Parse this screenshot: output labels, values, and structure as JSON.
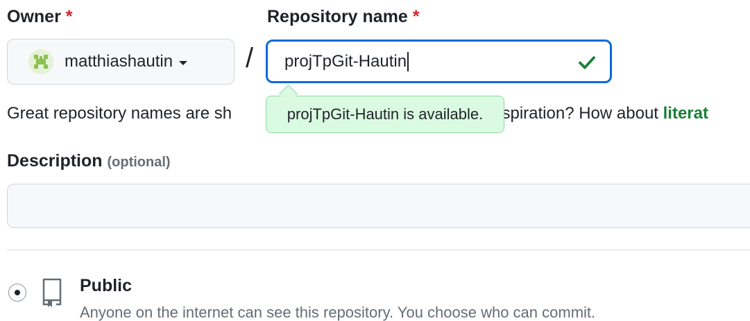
{
  "owner": {
    "label": "Owner",
    "required_mark": "*",
    "value": "matthiashautin"
  },
  "separator": "/",
  "repository_name": {
    "label": "Repository name",
    "required_mark": "*",
    "value": "projTpGit-Hautin",
    "availability_message": "projTpGit-Hautin is available."
  },
  "help": {
    "text_prefix": "Great repository names are sh",
    "text_middle": "nspiration? How about ",
    "suggestion": "literat"
  },
  "description": {
    "label": "Description",
    "optional_label": "(optional)",
    "value": ""
  },
  "visibility": {
    "public": {
      "title": "Public",
      "description": "Anyone on the internet can see this repository. You choose who can commit.",
      "selected": true
    }
  },
  "colors": {
    "focus_border": "#0969da",
    "success": "#1a7f37",
    "required": "#d1242f",
    "tooltip_bg": "#dafbe1"
  },
  "icons": {
    "avatar": "identicon-avatar",
    "check": "check-icon",
    "caret": "triangle-down-icon",
    "repo": "repo-icon"
  }
}
